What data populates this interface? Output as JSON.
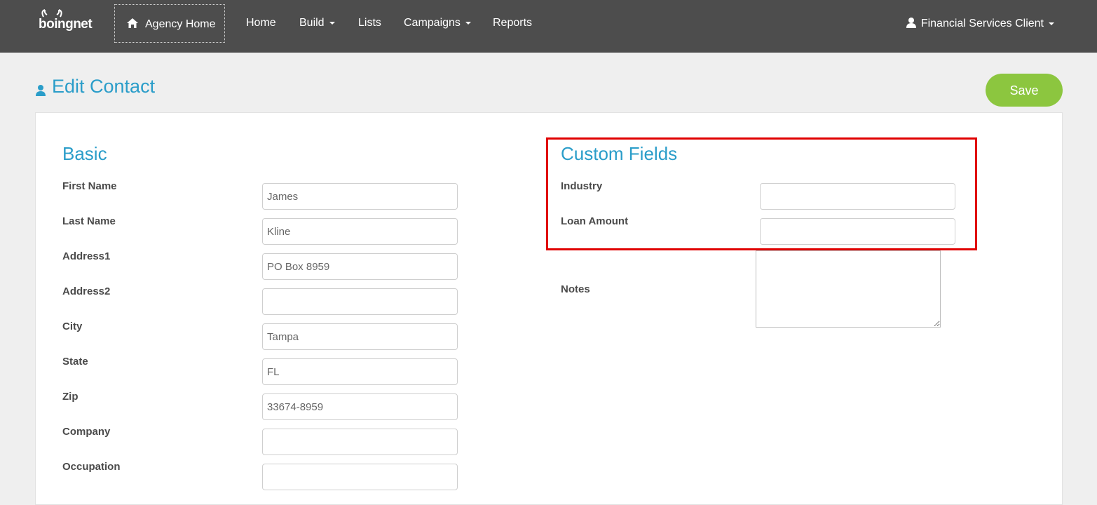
{
  "brand": {
    "logo_text": "boingnet"
  },
  "nav": {
    "agency_home": "Agency Home",
    "items": [
      {
        "label": "Home"
      },
      {
        "label": "Build"
      },
      {
        "label": "Lists"
      },
      {
        "label": "Campaigns"
      },
      {
        "label": "Reports"
      }
    ],
    "user": "Financial Services Client"
  },
  "page": {
    "title": "Edit Contact",
    "save_label": "Save"
  },
  "basic": {
    "title": "Basic",
    "fields": [
      {
        "label": "First Name",
        "value": "James"
      },
      {
        "label": "Last Name",
        "value": "Kline"
      },
      {
        "label": "Address1",
        "value": "PO Box 8959"
      },
      {
        "label": "Address2",
        "value": ""
      },
      {
        "label": "City",
        "value": "Tampa"
      },
      {
        "label": "State",
        "value": "FL"
      },
      {
        "label": "Zip",
        "value": "33674-8959"
      },
      {
        "label": "Company",
        "value": ""
      },
      {
        "label": "Occupation",
        "value": ""
      }
    ]
  },
  "custom": {
    "title": "Custom Fields",
    "fields": [
      {
        "label": "Industry",
        "value": ""
      },
      {
        "label": "Loan Amount",
        "value": ""
      }
    ],
    "notes_label": "Notes",
    "notes_value": ""
  },
  "colors": {
    "accent": "#2a9dc9",
    "save": "#8cc63f",
    "nav_bg": "#4d4d4d",
    "highlight": "#e00000"
  }
}
